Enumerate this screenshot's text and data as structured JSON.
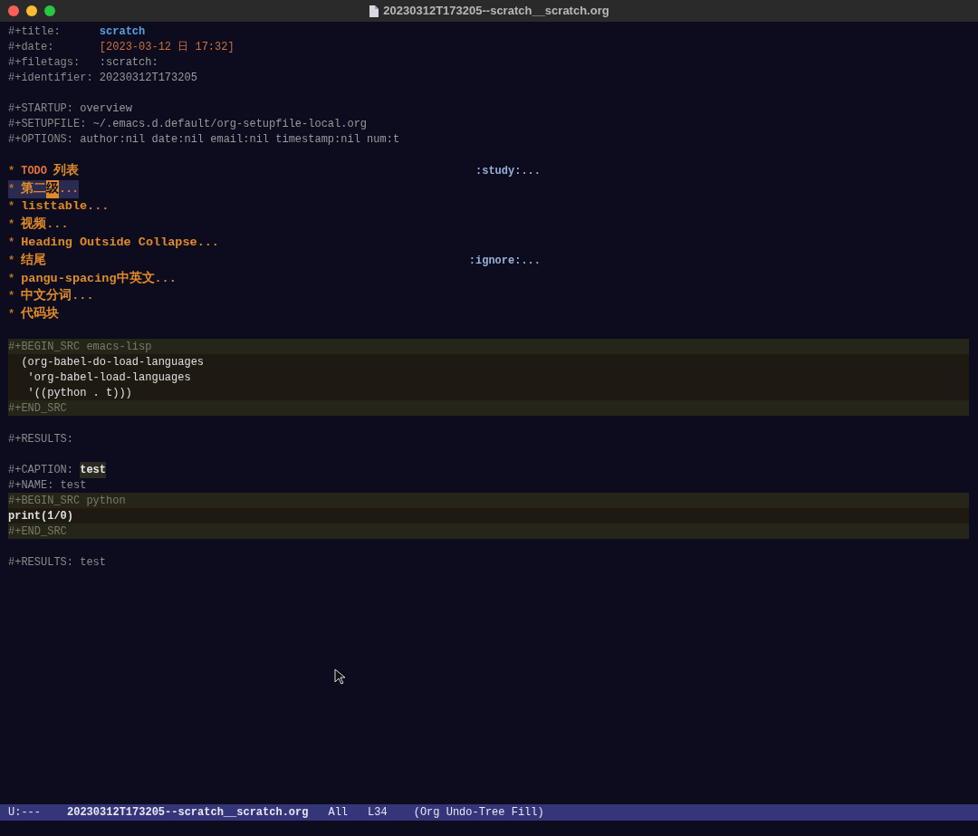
{
  "window": {
    "title": "20230312T173205--scratch__scratch.org"
  },
  "lines": [
    {
      "kind": "title",
      "key": "#+title:      ",
      "value": "scratch"
    },
    {
      "kind": "date",
      "key": "#+date:       ",
      "value": "[2023-03-12 日 17:32]"
    },
    {
      "kind": "keyword",
      "key": "#+filetags:   ",
      "value": ":scratch:"
    },
    {
      "kind": "keyword",
      "key": "#+identifier: ",
      "value": "20230312T173205"
    },
    {
      "kind": "blank"
    },
    {
      "kind": "keyword",
      "key": "#+STARTUP: ",
      "value": "overview"
    },
    {
      "kind": "keyword",
      "key": "#+SETUPFILE: ",
      "value": "~/.emacs.d.default/org-setupfile-local.org"
    },
    {
      "kind": "keyword",
      "key": "#+OPTIONS: ",
      "value": "author:nil date:nil email:nil timestamp:nil num:t"
    },
    {
      "kind": "blank"
    },
    {
      "kind": "heading",
      "star": "*",
      "todo": "TODO",
      "text": "列表",
      "tag": ":study:...",
      "selected": false
    },
    {
      "kind": "heading",
      "star": "*",
      "text": "第二",
      "cursor": "级",
      "rest": "...",
      "selected": true
    },
    {
      "kind": "heading",
      "star": "*",
      "text": "listtable...",
      "selected": false
    },
    {
      "kind": "heading",
      "star": "*",
      "text": "视频...",
      "selected": false
    },
    {
      "kind": "heading",
      "star": "*",
      "text": "Heading Outside Collapse...",
      "selected": false
    },
    {
      "kind": "heading",
      "star": "*",
      "text": "结尾",
      "tag": ":ignore:...",
      "selected": false
    },
    {
      "kind": "heading",
      "star": "*",
      "text": "pangu-spacing中英文...",
      "selected": false
    },
    {
      "kind": "heading",
      "star": "*",
      "text": "中文分词...",
      "selected": false
    },
    {
      "kind": "heading",
      "star": "*",
      "text": "代码块",
      "selected": false
    },
    {
      "kind": "blank"
    },
    {
      "kind": "src_delim",
      "text": "#+BEGIN_SRC emacs-lisp"
    },
    {
      "kind": "src_code",
      "text": "  (org-babel-do-load-languages"
    },
    {
      "kind": "src_code",
      "text": "   'org-babel-load-languages"
    },
    {
      "kind": "src_code",
      "text": "   '((python . t)))"
    },
    {
      "kind": "src_delim",
      "text": "#+END_SRC"
    },
    {
      "kind": "blank"
    },
    {
      "kind": "keyword",
      "key": "#+RESULTS:"
    },
    {
      "kind": "blank"
    },
    {
      "kind": "caption",
      "key": "#+CAPTION: ",
      "value": "test"
    },
    {
      "kind": "dim",
      "key": "#+NAME: ",
      "value": "test"
    },
    {
      "kind": "src_delim",
      "text": "#+BEGIN_SRC python"
    },
    {
      "kind": "python_code",
      "text": "print(1/0)"
    },
    {
      "kind": "src_delim",
      "text": "#+END_SRC"
    },
    {
      "kind": "blank"
    },
    {
      "kind": "dim",
      "key": "#+RESULTS: ",
      "value": "test"
    }
  ],
  "mode_line": {
    "state": "U:---",
    "buffer": "20230312T173205--scratch__scratch.org",
    "position": "All",
    "line": "L34",
    "modes": "(Org Undo-Tree Fill)"
  }
}
